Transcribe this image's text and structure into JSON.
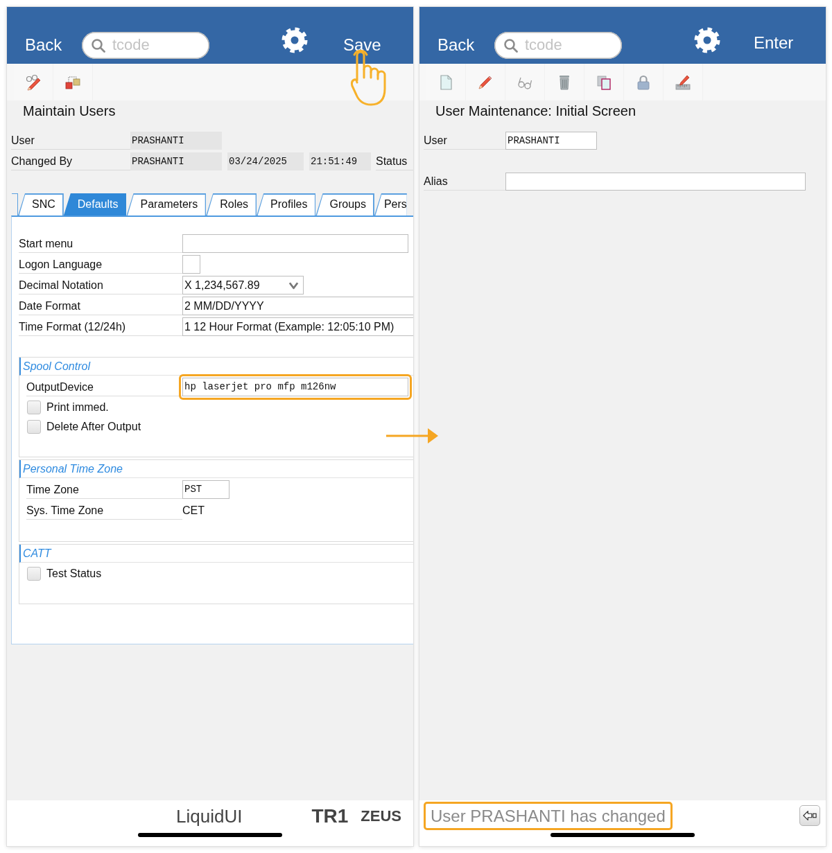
{
  "screens": [
    {
      "header": {
        "back": "Back",
        "search": {
          "placeholder": "tcode"
        },
        "action": {
          "label": "Save",
          "tapped": true
        }
      },
      "title": "Maintain Users",
      "header_fields": [
        {
          "label": "User",
          "values": [
            "PRASHANTI"
          ]
        },
        {
          "label": "Changed By",
          "values": [
            "PRASHANTI",
            "03/24/2025",
            "21:51:49"
          ],
          "trailing_label": "Status"
        }
      ],
      "tabs": [
        {
          "label": "SNC",
          "selected": false
        },
        {
          "label": "Defaults",
          "selected": true
        },
        {
          "label": "Parameters",
          "selected": false
        },
        {
          "label": "Roles",
          "selected": false
        },
        {
          "label": "Profiles",
          "selected": false
        },
        {
          "label": "Groups",
          "selected": false
        },
        {
          "label": "Pers",
          "selected": false
        }
      ],
      "panel": {
        "fields": [
          {
            "kind": "text",
            "label": "Start menu",
            "highlighted": false
          },
          {
            "kind": "char",
            "label": "Logon Language",
            "highlighted": false
          },
          {
            "kind": "dropdown",
            "label": "Decimal Notation",
            "value": "X 1,234,567.89",
            "highlighted": false
          },
          {
            "kind": "wide",
            "label": "Date Format",
            "value": "2 MM/DD/YYYY",
            "highlighted": false
          },
          {
            "kind": "wide",
            "label": "Time Format (12/24h)",
            "value": "1 12 Hour Format (Example: 12:05:10 PM)",
            "highlighted": false
          }
        ],
        "groups": [
          {
            "title": "Spool Control",
            "rows": [
              {
                "kind": "text",
                "label": "OutputDevice",
                "value": "hp laserjet pro mfp m126nw",
                "highlighted": true
              },
              {
                "kind": "checkbox",
                "label": "Print immed.",
                "checked": false,
                "highlighted": false
              },
              {
                "kind": "checkbox",
                "label": "Delete After Output",
                "checked": false,
                "highlighted": false
              }
            ]
          },
          {
            "title": "Personal Time Zone",
            "rows": [
              {
                "kind": "code",
                "label": "Time Zone",
                "value": "PST",
                "highlighted": false
              },
              {
                "kind": "display",
                "label": "Sys. Time Zone",
                "value": "CET",
                "highlighted": false
              }
            ]
          },
          {
            "title": "CATT",
            "rows": [
              {
                "kind": "checkbox",
                "label": "Test Status",
                "checked": false,
                "highlighted": false
              }
            ]
          }
        ]
      },
      "footer": {
        "brand": "LiquidUI",
        "system": "TR1",
        "server": "ZEUS"
      }
    },
    {
      "header": {
        "back": "Back",
        "search": {
          "placeholder": "tcode"
        },
        "action": {
          "label": "Enter",
          "tapped": false
        }
      },
      "title": "User Maintenance: Initial Screen",
      "fields": [
        {
          "kind": "id",
          "label": "User",
          "value": "PRASHANTI",
          "highlighted": false
        },
        {
          "kind": "long",
          "label": "Alias",
          "highlighted": false
        }
      ],
      "footer": {
        "message": "User PRASHANTI has changed",
        "highlighted": true
      }
    }
  ]
}
